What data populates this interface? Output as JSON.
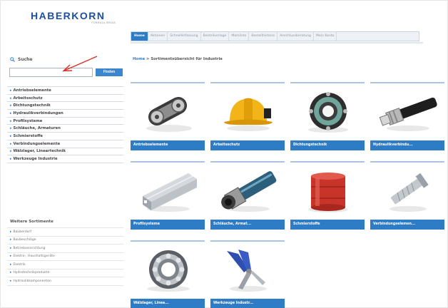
{
  "logo": {
    "text": "HABERKORN",
    "tagline": "FORMULA MEDIA"
  },
  "nav": {
    "items": [
      {
        "label": "Home",
        "active": true
      },
      {
        "label": "Aktionen",
        "active": false
      },
      {
        "label": "Schnellerfassung",
        "active": false
      },
      {
        "label": "Bestellvorlage",
        "active": false
      },
      {
        "label": "Merkliste",
        "active": false
      },
      {
        "label": "Bestellhistorie",
        "active": false
      },
      {
        "label": "Anschlussberatung",
        "active": false
      },
      {
        "label": "Mein Konto",
        "active": false
      }
    ]
  },
  "search": {
    "label": "Suche",
    "placeholder": "",
    "button": "Finden"
  },
  "sidebar": {
    "categories": [
      "Antriebselemente",
      "Arbeitsschutz",
      "Dichtungstechnik",
      "Hydraulikverbindungen",
      "Profilsysteme",
      "Schläuche, Armaturen",
      "Schmierstoffe",
      "Verbindungselemente",
      "Wälzlager, Lineartechnik",
      "Werkzeuge Industrie"
    ],
    "more_title": "Weitere Sortimente",
    "more": [
      "Bauberdarf",
      "Baubeschläge",
      "Betriebseinrichtung",
      "Elektro-, Haushaltsgeräte",
      "Elektrik",
      "Hydrotechnikprodukte",
      "Hydraulikkomponenten"
    ]
  },
  "breadcrumb": {
    "home": "Home",
    "separator": " > ",
    "current": "Sortimentsübersicht für Industrie"
  },
  "products": [
    {
      "label": "Antriebselemente",
      "icon": "gear-chain-icon"
    },
    {
      "label": "Arbeitsschutz",
      "icon": "hard-hat-icon"
    },
    {
      "label": "Dichtungstechnik",
      "icon": "seal-ring-icon"
    },
    {
      "label": "Hydraulikverbindu...",
      "icon": "hydraulic-hose-icon"
    },
    {
      "label": "Profilsysteme",
      "icon": "aluminium-profile-icon"
    },
    {
      "label": "Schläuche, Armat...",
      "icon": "hose-coupling-icon"
    },
    {
      "label": "Schmierstoffe",
      "icon": "oil-barrel-icon"
    },
    {
      "label": "Verbindungselemen...",
      "icon": "bolt-anchor-icon"
    },
    {
      "label": "Wälzlager, Linea...",
      "icon": "ball-bearing-icon"
    },
    {
      "label": "Werkzeuge Industr...",
      "icon": "pliers-icon"
    }
  ],
  "colors": {
    "accent": "#2f7cc6",
    "brand": "#1c4fa0",
    "annotation": "#d9302a"
  }
}
